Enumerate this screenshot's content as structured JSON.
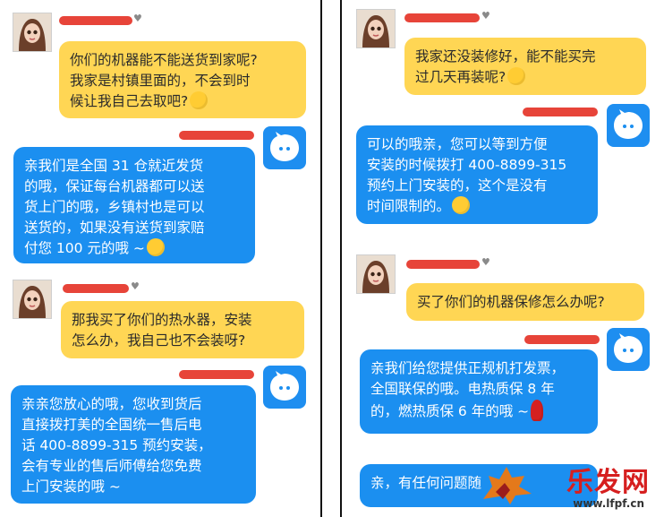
{
  "left": {
    "messages": [
      {
        "text": "你们的机器能不能送货到家呢?\n我家是村镇里面的，不会到时\n候让我自己去取吧?"
      },
      {
        "text": "亲我们是全国 31 仓就近发货\n的哦，保证每台机器都可以送\n货上门的哦，乡镇村也是可以\n送货的，如果没有送货到家赔\n付您 100 元的哦 ~"
      },
      {
        "text": "那我买了你们的热水器，安装\n怎么办，我自己也不会装呀?"
      },
      {
        "text": "亲亲您放心的哦，您收到货后\n直接拨打美的全国统一售后电\n话 400-8899-315 预约安装，\n会有专业的售后师傅给您免费\n上门安装的哦 ~"
      }
    ]
  },
  "right": {
    "messages": [
      {
        "text": "我家还没装修好，能不能买完\n过几天再装呢?"
      },
      {
        "text": "可以的哦亲，您可以等到方便\n安装的时候拨打 400-8899-315\n预约上门安装的，这个是没有\n时间限制的。"
      },
      {
        "text": "买了你们的机器保修怎么办呢?"
      },
      {
        "text": "亲我们给您提供正规机打发票，\n全国联保的哦。电热质保 8 年\n的，燃热质保 6 年的哦 ~"
      },
      {
        "text": "亲，有任何问题随"
      }
    ]
  },
  "icons": {
    "user_avatar": "girl-avatar-icon",
    "bot_avatar": "chat-bot-icon",
    "emoji_a": "smile-emoji-icon",
    "emoji_b": "eye-emoji-icon",
    "emoji_c": "blush-emoji-icon",
    "emoji_d": "rose-icon"
  },
  "colors": {
    "user_bubble": "#ffd654",
    "bot_bubble": "#1b8ff0",
    "name_mark": "#e63a2e",
    "watermark": "#d61f1f"
  },
  "watermark": {
    "text": "乐发网",
    "url": "www.lfpf.cn"
  }
}
